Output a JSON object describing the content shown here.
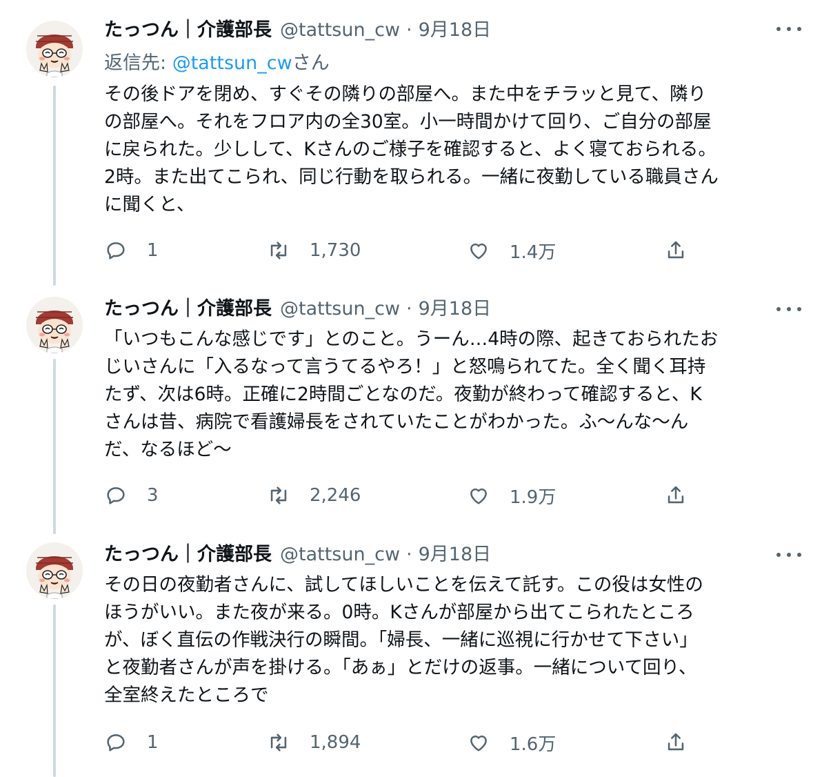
{
  "tweets": [
    {
      "author": {
        "display_name": "たっつん｜介護部長",
        "handle": "@tattsun_cw",
        "separator": "·",
        "date": "9月18日",
        "avatar_icon": "cartoon-avatar-icon"
      },
      "reply_to": {
        "label": "返信先: ",
        "mention": "@tattsun_cw",
        "suffix": "さん"
      },
      "text": "その後ドアを閉め、すぐその隣りの部屋へ。また中をチラッと見て、隣り\nの部屋へ。それをフロア内の全30室。小一時間かけて回り、ご自分の部屋\nに戻られた。少しして、Kさんのご様子を確認すると、よく寝ておられる。\n2時。また出てこられ、同じ行動を取られる。一緒に夜勤している職員さん\nに聞くと、",
      "actions": {
        "reply_count": "1",
        "retweet_count": "1,730",
        "like_count": "1.4万"
      }
    },
    {
      "author": {
        "display_name": "たっつん｜介護部長",
        "handle": "@tattsun_cw",
        "separator": "·",
        "date": "9月18日",
        "avatar_icon": "cartoon-avatar-icon"
      },
      "text": "「いつもこんな感じです」とのこと。うーん…4時の際、起きておられたお\nじいさんに「入るなって言うてるやろ！」と怒鳴られてた。全く聞く耳持\nたず、次は6時。正確に2時間ごとなのだ。夜勤が終わって確認すると、K\nさんは昔、病院で看護婦長をされていたことがわかった。ふ〜んな〜ん\nだ、なるほど〜",
      "actions": {
        "reply_count": "3",
        "retweet_count": "2,246",
        "like_count": "1.9万"
      }
    },
    {
      "author": {
        "display_name": "たっつん｜介護部長",
        "handle": "@tattsun_cw",
        "separator": "·",
        "date": "9月18日",
        "avatar_icon": "cartoon-avatar-icon"
      },
      "text": "その日の夜勤者さんに、試してほしいことを伝えて託す。この役は女性の\nほうがいい。また夜が来る。0時。Kさんが部屋から出てこられたところ\nが、ぼく直伝の作戦決行の瞬間。「婦長、一緒に巡視に行かせて下さい」\nと夜勤者さんが声を掛ける。「あぁ」とだけの返事。一緒について回り、\n全室終えたところで",
      "actions": {
        "reply_count": "1",
        "retweet_count": "1,894",
        "like_count": "1.6万"
      }
    }
  ],
  "icons": {
    "reply": "reply-icon",
    "retweet": "retweet-icon",
    "like": "heart-icon",
    "share": "share-icon",
    "more": "more-options-icon"
  },
  "colors": {
    "text_primary": "#0f1419",
    "text_secondary": "#536471",
    "mention": "#1d9bf0",
    "thread_line": "#cfd9de",
    "avatar_hat": "#a23b33"
  }
}
